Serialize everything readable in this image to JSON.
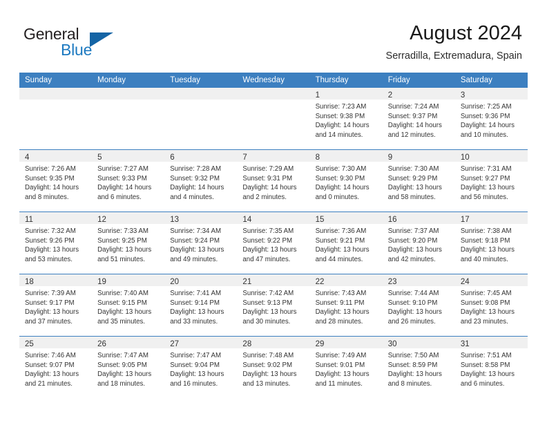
{
  "brand": {
    "name_part1": "General",
    "name_part2": "Blue",
    "accent_color": "#1c79c0",
    "triangle_color": "#1464a5"
  },
  "header": {
    "title": "August 2024",
    "subtitle": "Serradilla, Extremadura, Spain"
  },
  "calendar": {
    "header_bg": "#3c7fc0",
    "weekday_headers": [
      "Sunday",
      "Monday",
      "Tuesday",
      "Wednesday",
      "Thursday",
      "Friday",
      "Saturday"
    ],
    "weeks": [
      [
        {
          "day": "",
          "lines": []
        },
        {
          "day": "",
          "lines": []
        },
        {
          "day": "",
          "lines": []
        },
        {
          "day": "",
          "lines": []
        },
        {
          "day": "1",
          "lines": [
            "Sunrise: 7:23 AM",
            "Sunset: 9:38 PM",
            "Daylight: 14 hours",
            "and 14 minutes."
          ]
        },
        {
          "day": "2",
          "lines": [
            "Sunrise: 7:24 AM",
            "Sunset: 9:37 PM",
            "Daylight: 14 hours",
            "and 12 minutes."
          ]
        },
        {
          "day": "3",
          "lines": [
            "Sunrise: 7:25 AM",
            "Sunset: 9:36 PM",
            "Daylight: 14 hours",
            "and 10 minutes."
          ]
        }
      ],
      [
        {
          "day": "4",
          "lines": [
            "Sunrise: 7:26 AM",
            "Sunset: 9:35 PM",
            "Daylight: 14 hours",
            "and 8 minutes."
          ]
        },
        {
          "day": "5",
          "lines": [
            "Sunrise: 7:27 AM",
            "Sunset: 9:33 PM",
            "Daylight: 14 hours",
            "and 6 minutes."
          ]
        },
        {
          "day": "6",
          "lines": [
            "Sunrise: 7:28 AM",
            "Sunset: 9:32 PM",
            "Daylight: 14 hours",
            "and 4 minutes."
          ]
        },
        {
          "day": "7",
          "lines": [
            "Sunrise: 7:29 AM",
            "Sunset: 9:31 PM",
            "Daylight: 14 hours",
            "and 2 minutes."
          ]
        },
        {
          "day": "8",
          "lines": [
            "Sunrise: 7:30 AM",
            "Sunset: 9:30 PM",
            "Daylight: 14 hours",
            "and 0 minutes."
          ]
        },
        {
          "day": "9",
          "lines": [
            "Sunrise: 7:30 AM",
            "Sunset: 9:29 PM",
            "Daylight: 13 hours",
            "and 58 minutes."
          ]
        },
        {
          "day": "10",
          "lines": [
            "Sunrise: 7:31 AM",
            "Sunset: 9:27 PM",
            "Daylight: 13 hours",
            "and 56 minutes."
          ]
        }
      ],
      [
        {
          "day": "11",
          "lines": [
            "Sunrise: 7:32 AM",
            "Sunset: 9:26 PM",
            "Daylight: 13 hours",
            "and 53 minutes."
          ]
        },
        {
          "day": "12",
          "lines": [
            "Sunrise: 7:33 AM",
            "Sunset: 9:25 PM",
            "Daylight: 13 hours",
            "and 51 minutes."
          ]
        },
        {
          "day": "13",
          "lines": [
            "Sunrise: 7:34 AM",
            "Sunset: 9:24 PM",
            "Daylight: 13 hours",
            "and 49 minutes."
          ]
        },
        {
          "day": "14",
          "lines": [
            "Sunrise: 7:35 AM",
            "Sunset: 9:22 PM",
            "Daylight: 13 hours",
            "and 47 minutes."
          ]
        },
        {
          "day": "15",
          "lines": [
            "Sunrise: 7:36 AM",
            "Sunset: 9:21 PM",
            "Daylight: 13 hours",
            "and 44 minutes."
          ]
        },
        {
          "day": "16",
          "lines": [
            "Sunrise: 7:37 AM",
            "Sunset: 9:20 PM",
            "Daylight: 13 hours",
            "and 42 minutes."
          ]
        },
        {
          "day": "17",
          "lines": [
            "Sunrise: 7:38 AM",
            "Sunset: 9:18 PM",
            "Daylight: 13 hours",
            "and 40 minutes."
          ]
        }
      ],
      [
        {
          "day": "18",
          "lines": [
            "Sunrise: 7:39 AM",
            "Sunset: 9:17 PM",
            "Daylight: 13 hours",
            "and 37 minutes."
          ]
        },
        {
          "day": "19",
          "lines": [
            "Sunrise: 7:40 AM",
            "Sunset: 9:15 PM",
            "Daylight: 13 hours",
            "and 35 minutes."
          ]
        },
        {
          "day": "20",
          "lines": [
            "Sunrise: 7:41 AM",
            "Sunset: 9:14 PM",
            "Daylight: 13 hours",
            "and 33 minutes."
          ]
        },
        {
          "day": "21",
          "lines": [
            "Sunrise: 7:42 AM",
            "Sunset: 9:13 PM",
            "Daylight: 13 hours",
            "and 30 minutes."
          ]
        },
        {
          "day": "22",
          "lines": [
            "Sunrise: 7:43 AM",
            "Sunset: 9:11 PM",
            "Daylight: 13 hours",
            "and 28 minutes."
          ]
        },
        {
          "day": "23",
          "lines": [
            "Sunrise: 7:44 AM",
            "Sunset: 9:10 PM",
            "Daylight: 13 hours",
            "and 26 minutes."
          ]
        },
        {
          "day": "24",
          "lines": [
            "Sunrise: 7:45 AM",
            "Sunset: 9:08 PM",
            "Daylight: 13 hours",
            "and 23 minutes."
          ]
        }
      ],
      [
        {
          "day": "25",
          "lines": [
            "Sunrise: 7:46 AM",
            "Sunset: 9:07 PM",
            "Daylight: 13 hours",
            "and 21 minutes."
          ]
        },
        {
          "day": "26",
          "lines": [
            "Sunrise: 7:47 AM",
            "Sunset: 9:05 PM",
            "Daylight: 13 hours",
            "and 18 minutes."
          ]
        },
        {
          "day": "27",
          "lines": [
            "Sunrise: 7:47 AM",
            "Sunset: 9:04 PM",
            "Daylight: 13 hours",
            "and 16 minutes."
          ]
        },
        {
          "day": "28",
          "lines": [
            "Sunrise: 7:48 AM",
            "Sunset: 9:02 PM",
            "Daylight: 13 hours",
            "and 13 minutes."
          ]
        },
        {
          "day": "29",
          "lines": [
            "Sunrise: 7:49 AM",
            "Sunset: 9:01 PM",
            "Daylight: 13 hours",
            "and 11 minutes."
          ]
        },
        {
          "day": "30",
          "lines": [
            "Sunrise: 7:50 AM",
            "Sunset: 8:59 PM",
            "Daylight: 13 hours",
            "and 8 minutes."
          ]
        },
        {
          "day": "31",
          "lines": [
            "Sunrise: 7:51 AM",
            "Sunset: 8:58 PM",
            "Daylight: 13 hours",
            "and 6 minutes."
          ]
        }
      ]
    ]
  }
}
